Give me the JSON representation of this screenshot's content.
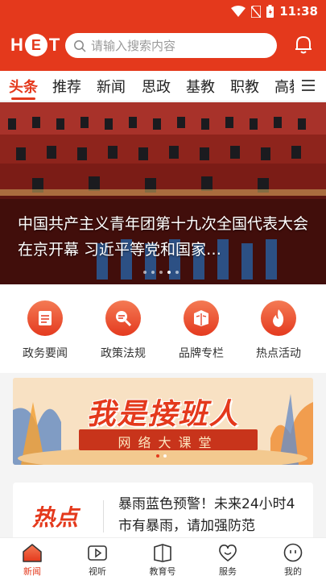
{
  "status": {
    "time": "11:38"
  },
  "header": {
    "logo_h": "H",
    "logo_e": "E",
    "logo_t": "T",
    "search_placeholder": "请输入搜索内容"
  },
  "tabs": [
    {
      "label": "头条",
      "active": true
    },
    {
      "label": "推荐"
    },
    {
      "label": "新闻"
    },
    {
      "label": "思政"
    },
    {
      "label": "基教"
    },
    {
      "label": "职教"
    },
    {
      "label": "高教"
    }
  ],
  "banner": {
    "title": "中国共产主义青年团第十九次全国代表大会在京开幕 习近平等党和国家…"
  },
  "quick_links": [
    {
      "label": "政务要闻",
      "icon": "document-icon"
    },
    {
      "label": "政策法规",
      "icon": "search-doc-icon"
    },
    {
      "label": "品牌专栏",
      "icon": "book-icon"
    },
    {
      "label": "热点活动",
      "icon": "flame-icon"
    }
  ],
  "promo": {
    "title": "我是接班人",
    "subtitle": "网络大课堂"
  },
  "hot": {
    "logo": "热点",
    "text": "暴雨蓝色预警！未来24小时4市有暴雨，请加强防范"
  },
  "bottom_nav": [
    {
      "label": "新闻",
      "icon": "home-icon",
      "active": true
    },
    {
      "label": "视听",
      "icon": "video-icon"
    },
    {
      "label": "教育号",
      "icon": "book-icon"
    },
    {
      "label": "服务",
      "icon": "service-icon"
    },
    {
      "label": "我的",
      "icon": "profile-icon"
    }
  ],
  "colors": {
    "brand": "#e4391c",
    "background": "#f4f4f4"
  }
}
